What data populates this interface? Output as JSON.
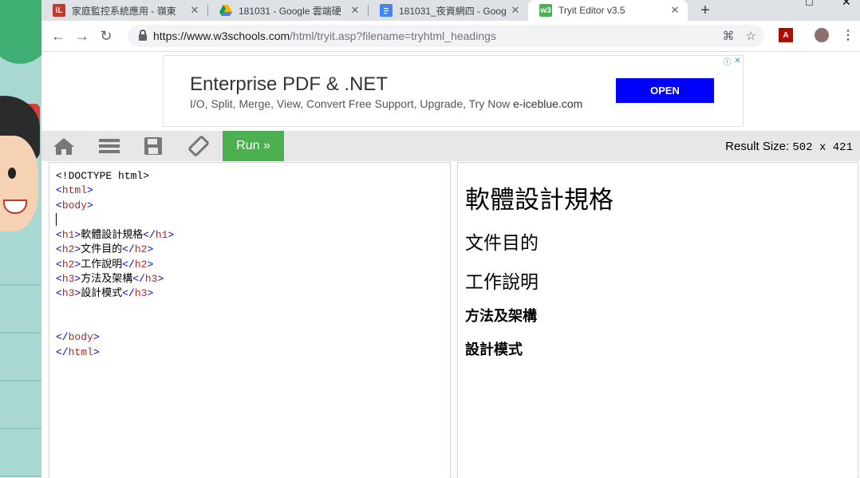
{
  "tabs": [
    {
      "title": "家庭監控系統應用 - 嶺東",
      "favicon": "iL",
      "favicon_color": "#c0392b"
    },
    {
      "title": "181031 - Google 雲端硬",
      "favicon": "drive-icon",
      "favicon_color": "#f4b400"
    },
    {
      "title": "181031_夜資網四 - Goog",
      "favicon": "docs-icon",
      "favicon_color": "#4285f4"
    },
    {
      "title": "Tryit Editor v3.5",
      "favicon": "w3",
      "favicon_color": "#4caf50"
    }
  ],
  "address": {
    "host": "https://www.w3schools.com",
    "path": "/html/tryit.asp?filename=tryhtml_headings"
  },
  "ad": {
    "title": "Enterprise PDF & .NET",
    "subtitle": "I/O, Split, Merge, View, Convert Free Support, Upgrade, Try Now",
    "domain": "e-iceblue.com",
    "button": "OPEN"
  },
  "toolbar": {
    "run_label": "Run »",
    "result_size_label": "Result Size:",
    "result_size_value": "502 x 421"
  },
  "editor": {
    "lines": [
      {
        "kind": "plain",
        "text": "<!DOCTYPE html>"
      },
      {
        "kind": "tag",
        "open": "<",
        "name": "html",
        "close": ">"
      },
      {
        "kind": "tag",
        "open": "<",
        "name": "body",
        "close": ">"
      },
      {
        "kind": "cursor"
      },
      {
        "kind": "elem",
        "tag": "h1",
        "content": "軟體設計規格"
      },
      {
        "kind": "elem",
        "tag": "h2",
        "content": "文件目的"
      },
      {
        "kind": "elem",
        "tag": "h2",
        "content": "工作說明"
      },
      {
        "kind": "elem",
        "tag": "h3",
        "content": "方法及架構"
      },
      {
        "kind": "elem",
        "tag": "h3",
        "content": "設計模式"
      },
      {
        "kind": "blank"
      },
      {
        "kind": "blank"
      },
      {
        "kind": "tag",
        "open": "</",
        "name": "body",
        "close": ">"
      },
      {
        "kind": "tag",
        "open": "</",
        "name": "html",
        "close": ">"
      }
    ]
  },
  "result": {
    "h1": "軟體設計規格",
    "h2_1": "文件目的",
    "h2_2": "工作說明",
    "h3_1": "方法及架構",
    "h3_2": "設計模式"
  }
}
